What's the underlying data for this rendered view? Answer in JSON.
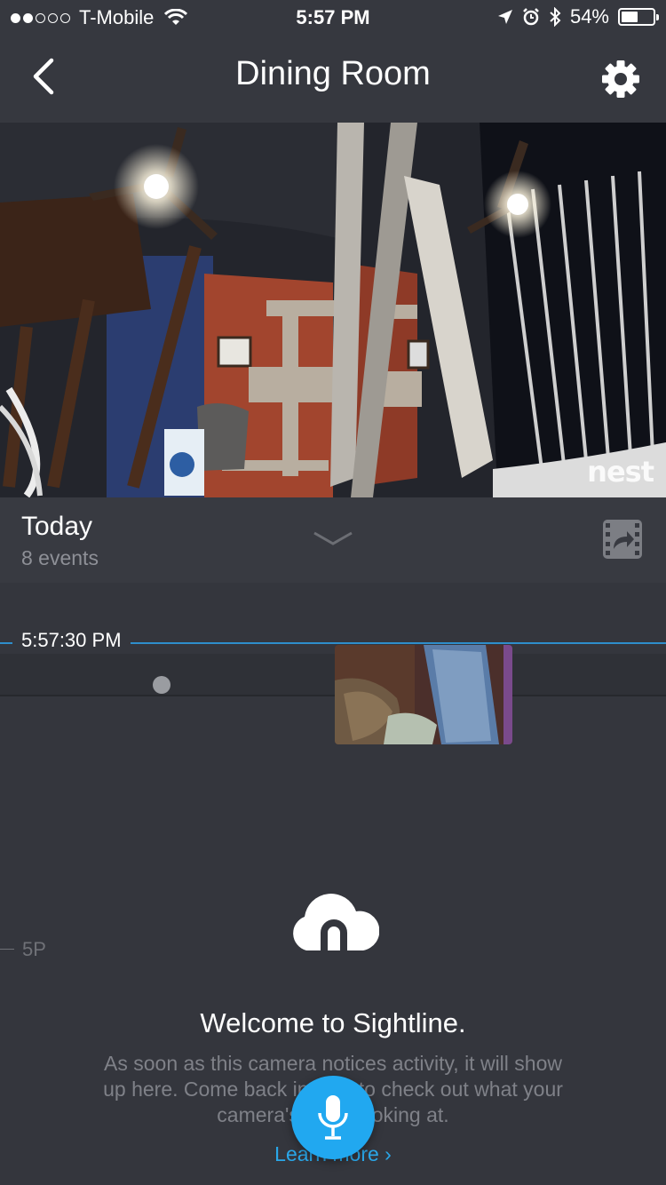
{
  "status_bar": {
    "carrier": "T-Mobile",
    "time": "5:57 PM",
    "battery_percent": "54%",
    "battery_level": 0.54,
    "signal_bars": 2,
    "icons": [
      "wifi-icon",
      "location-icon",
      "alarm-icon",
      "bluetooth-icon",
      "battery-icon"
    ]
  },
  "header": {
    "title": "Dining Room",
    "back_icon": "chevron-left-icon",
    "settings_icon": "gear-icon"
  },
  "camera": {
    "watermark": "nest"
  },
  "timeline_header": {
    "day": "Today",
    "events": "8 events",
    "expand_icon": "chevron-down-icon",
    "share_icon": "share-clip-icon"
  },
  "timeline": {
    "current_time": "5:57:30 PM",
    "hour_marker": "5P",
    "accent_color": "#2e8ecb"
  },
  "empty_state": {
    "icon": "sightline-cloud-icon",
    "title": "Welcome to Sightline.",
    "description": "As soon as this camera notices activity, it will show up here. Come back in a bit to check out what your camera's been looking at.",
    "link": "Learn more",
    "link_color": "#2aa7e9"
  },
  "mic_button": {
    "icon": "microphone-icon",
    "color": "#21a8f0"
  }
}
